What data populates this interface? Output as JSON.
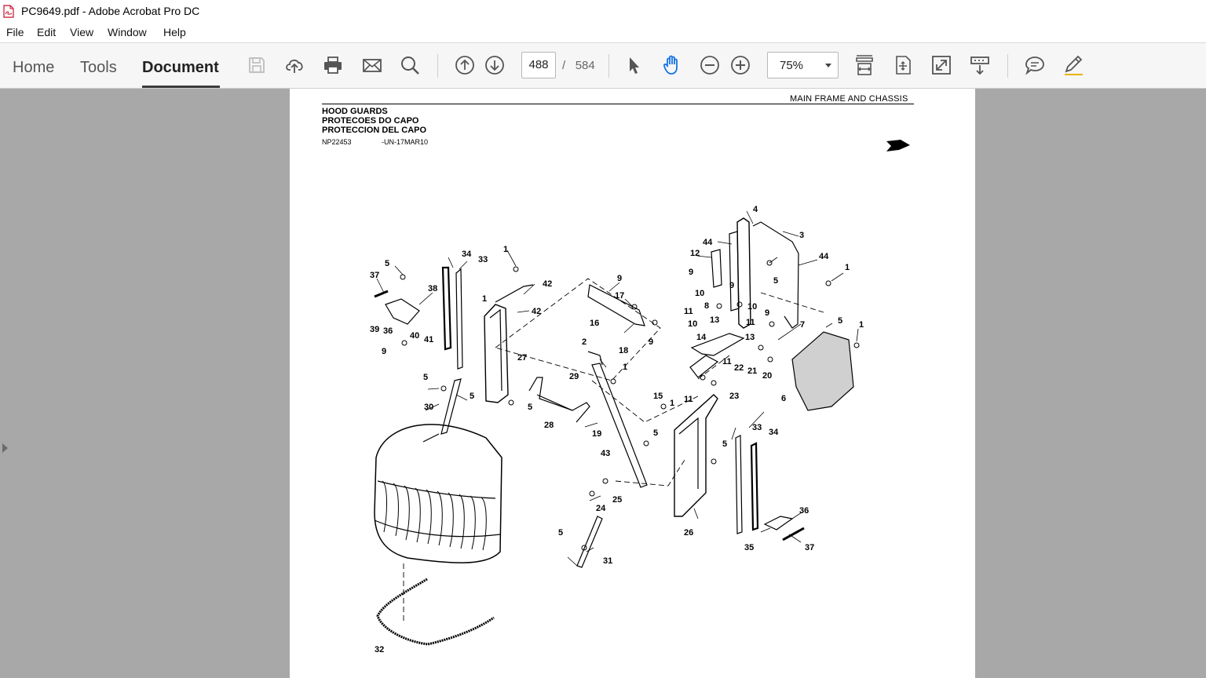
{
  "window": {
    "title": "PC9649.pdf - Adobe Acrobat Pro DC"
  },
  "menu": {
    "file": "File",
    "edit": "Edit",
    "view": "View",
    "window": "Window",
    "help": "Help"
  },
  "nav": {
    "home": "Home",
    "tools": "Tools",
    "document": "Document"
  },
  "toolbar": {
    "page_current": "488",
    "page_separator": "/",
    "page_total": "584",
    "zoom": "75%",
    "icons": [
      "save-icon",
      "cloud-upload-icon",
      "print-icon",
      "email-icon",
      "search-icon",
      "page-up-icon",
      "page-down-icon",
      "select-arrow-icon",
      "hand-tool-icon",
      "zoom-out-icon",
      "zoom-in-icon",
      "fit-page-icon",
      "fit-width-icon",
      "full-screen-icon",
      "read-mode-icon",
      "comment-icon",
      "sign-pen-icon"
    ]
  },
  "document": {
    "section": "MAIN FRAME AND CHASSIS",
    "title_en": "HOOD GUARDS",
    "title_pt": "PROTECOES DO CAPO",
    "title_es": "PROTECCION DEL CAPO",
    "ref_number": "NP22453",
    "ref_code": "-UN-17MAR10",
    "callouts": [
      "1",
      "2",
      "3",
      "4",
      "5",
      "6",
      "7",
      "8",
      "9",
      "10",
      "11",
      "12",
      "13",
      "14",
      "15",
      "16",
      "17",
      "18",
      "19",
      "20",
      "21",
      "22",
      "23",
      "24",
      "25",
      "26",
      "27",
      "28",
      "29",
      "30",
      "31",
      "32",
      "33",
      "34",
      "35",
      "36",
      "37",
      "38",
      "39",
      "40",
      "41",
      "42",
      "43",
      "44"
    ]
  },
  "colors": {
    "workspace": "#a8a8a8",
    "toolbar": "#f6f6f6",
    "active_tool": "#1473e6"
  }
}
